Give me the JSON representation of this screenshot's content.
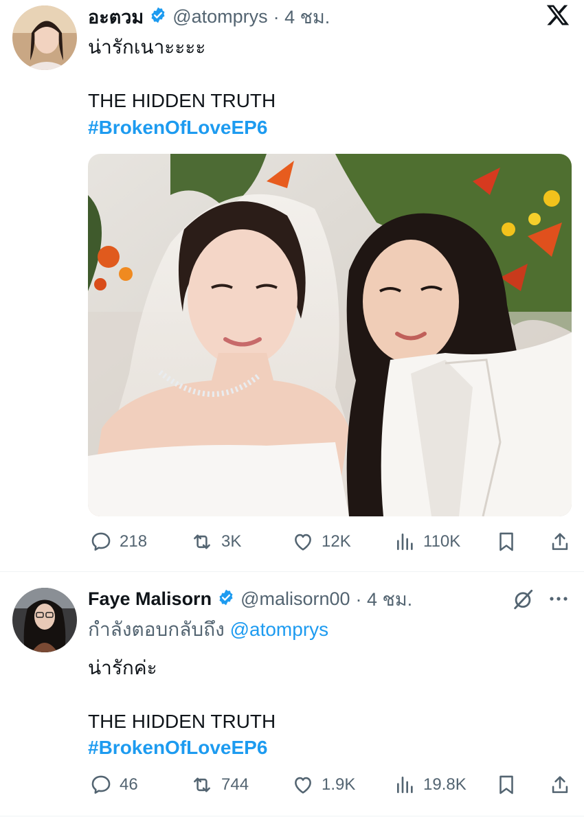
{
  "colors": {
    "accent": "#1d9bf0",
    "text": "#0f1419",
    "muted": "#536471",
    "divider": "#eff3f4"
  },
  "platform_icon": "x-logo-icon",
  "tweets": [
    {
      "display_name": "อะตวม",
      "handle": "@atomprys",
      "time": "· 4 ชม.",
      "verified": true,
      "text_line": "น่ารักเนาะะะะ",
      "title_line": "THE HIDDEN TRUTH",
      "hashtag": "#BrokenOfLoveEP6",
      "has_photo": true,
      "stats": {
        "replies": "218",
        "reposts": "3K",
        "likes": "12K",
        "views": "110K"
      }
    },
    {
      "display_name": "Faye Malisorn",
      "handle": "@malisorn00",
      "time": "· 4 ชม.",
      "verified": true,
      "reply_prefix": "กำลังตอบกลับถึง",
      "reply_to": "@atomprys",
      "text_line": "น่ารักค่ะ",
      "title_line": "THE HIDDEN TRUTH",
      "hashtag": "#BrokenOfLoveEP6",
      "stats": {
        "replies": "46",
        "reposts": "744",
        "likes": "1.9K",
        "views": "19.8K"
      }
    }
  ]
}
